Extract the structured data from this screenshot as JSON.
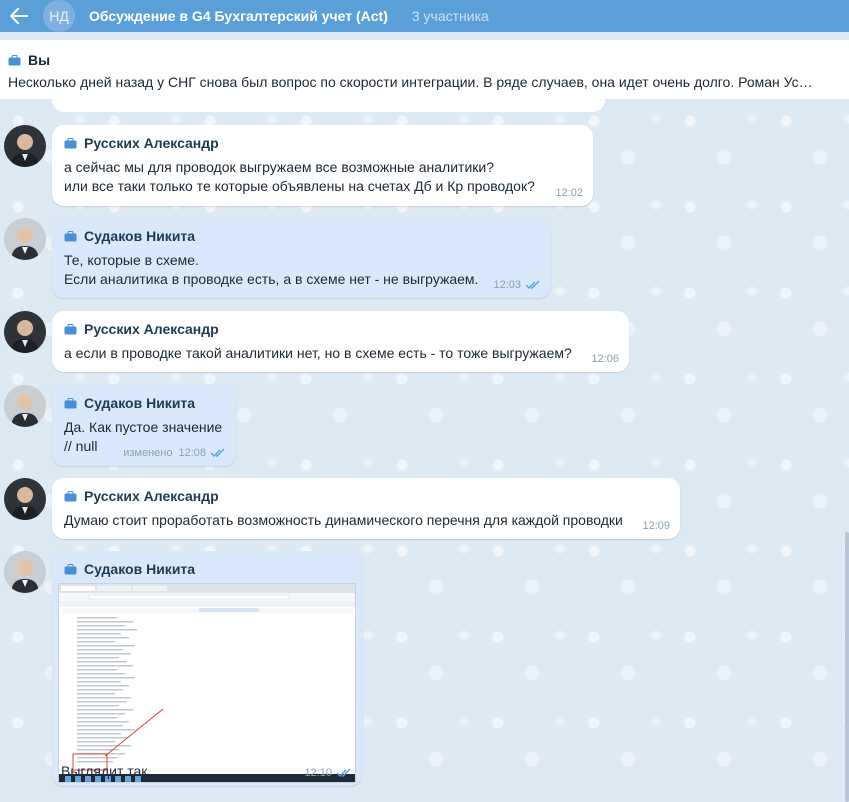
{
  "header": {
    "back_icon": "arrow-left-icon",
    "avatar_initials": "НД",
    "title": "Обсуждение в G4 Бухгалтерский учет (Act)",
    "participants": "3 участника"
  },
  "pinned": {
    "author": "Вы",
    "text": "Несколько дней назад у СНГ снова был вопрос по скорости интеграции. В ряде случаев, она идет очень долго. Роман Ус…"
  },
  "messages": [
    {
      "sender": "Русских Александр",
      "lines": [
        "а сейчас мы для проводок выгружаем все возможные аналитики?",
        "или все таки только те которые объявлены на счетах Дб и Кр проводок?"
      ],
      "time": "12:02"
    },
    {
      "sender": "Судаков Никита",
      "lines": [
        "Те, которые в схеме.",
        "Если аналитика в проводке есть, а в схеме нет - не выгружаем."
      ],
      "time": "12:03"
    },
    {
      "sender": "Русских Александр",
      "lines": [
        "а если в проводке такой аналитики нет, но в схеме есть - то тоже выгружаем?"
      ],
      "time": "12:06"
    },
    {
      "sender": "Судаков Никита",
      "lines": [
        "Да. Как пустое значение",
        "// null"
      ],
      "edited": "изменено",
      "time": "12:08"
    },
    {
      "sender": "Русских Александр",
      "lines": [
        "Думаю стоит проработать возможность динамического перечня для каждой проводки"
      ],
      "time": "12:09"
    },
    {
      "sender": "Судаков Никита",
      "caption": "Выглядит так",
      "time": "12:10"
    }
  ],
  "colors": {
    "header_bg": "#5b9fd8",
    "incoming_bubble": "#ffffff",
    "outgoing_bubble": "#d9e8fb",
    "chat_bg": "#dde9f3",
    "accent_case": "#4a8fd6",
    "read_checks": "#5aa0e6"
  }
}
